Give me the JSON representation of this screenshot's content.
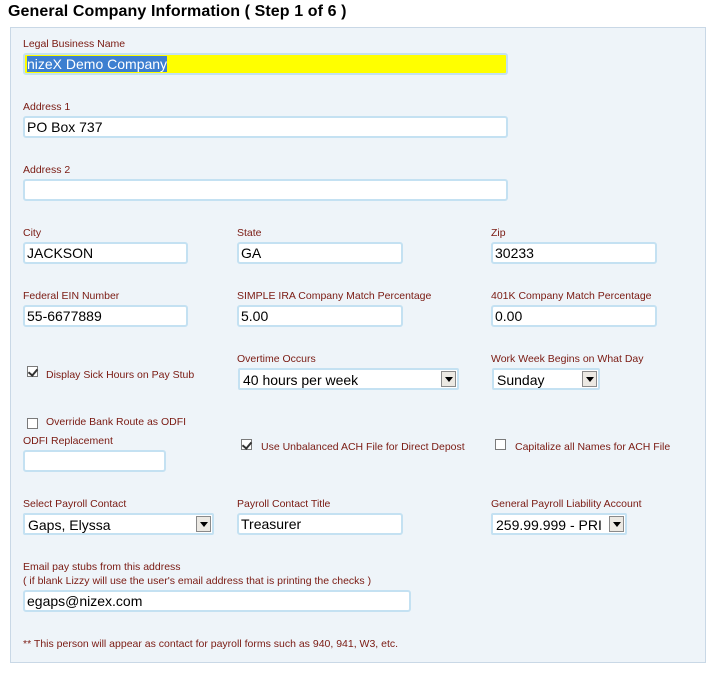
{
  "title": "General Company Information ( Step 1 of 6 )",
  "fields": {
    "legal_name": {
      "label": "Legal Business Name",
      "value_prefix": "nizeX Demo Company"
    },
    "address1": {
      "label": "Address 1",
      "value": "PO Box 737"
    },
    "address2": {
      "label": "Address 2",
      "value": ""
    },
    "city": {
      "label": "City",
      "value": "JACKSON"
    },
    "state": {
      "label": "State",
      "value": "GA"
    },
    "zip": {
      "label": "Zip",
      "value": "30233"
    },
    "ein": {
      "label": "Federal EIN Number",
      "value": "55-6677889"
    },
    "simple_ira": {
      "label": "SIMPLE IRA Company Match Percentage",
      "value": "5.00"
    },
    "k401": {
      "label": "401K Company Match Percentage",
      "value": "0.00"
    },
    "sick_hours": {
      "label": "Display Sick Hours on Pay Stub",
      "checked": true
    },
    "overtime": {
      "label": "Overtime Occurs",
      "value": "40 hours per week"
    },
    "work_week": {
      "label": "Work Week Begins on What Day",
      "value": "Sunday"
    },
    "override_bank": {
      "label": "Override Bank Route as ODFI",
      "checked": false
    },
    "odfi": {
      "label": "ODFI Replacement",
      "value": ""
    },
    "unbalanced_ach": {
      "label": "Use Unbalanced ACH File for Direct Depost",
      "checked": true
    },
    "capitalize": {
      "label": "Capitalize all Names for ACH File",
      "checked": false
    },
    "payroll_contact": {
      "label": "Select Payroll Contact",
      "value": "Gaps, Elyssa"
    },
    "contact_title": {
      "label": "Payroll Contact Title",
      "value": "Treasurer"
    },
    "liability": {
      "label": "General Payroll Liability Account",
      "value": "259.99.999 - PRI"
    },
    "email": {
      "label": "Email pay stubs from this address",
      "hint": "( if blank Lizzy will use the user's email address that is printing the checks )",
      "value": "egaps@nizex.com"
    }
  },
  "footnote": "** This person will appear as contact for payroll forms such as 940, 941, W3, etc."
}
